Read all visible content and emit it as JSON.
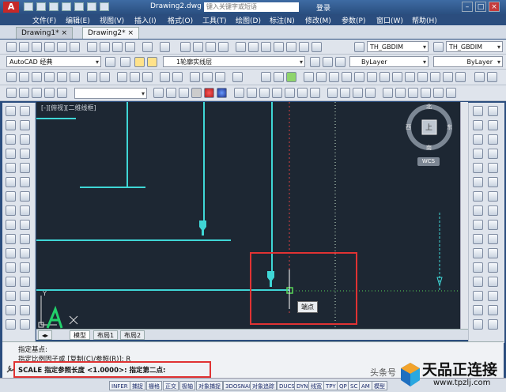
{
  "title": {
    "doc_title": "Drawing2.dwg",
    "search_placeholder": "键入关键字或短语",
    "login": "登录"
  },
  "menu": [
    "文件(F)",
    "编辑(E)",
    "视图(V)",
    "插入(I)",
    "格式(O)",
    "工具(T)",
    "绘图(D)",
    "标注(N)",
    "修改(M)",
    "参数(P)",
    "窗口(W)",
    "帮助(H)"
  ],
  "doc_tabs": [
    "Drawing1*",
    "Drawing2*"
  ],
  "toolbars": {
    "text_style": "TH_GBDIM",
    "dim_style": "TH_GBDIM",
    "workspace": "AutoCAD 经典",
    "layer": "1轮廓实线层",
    "color": "ByLayer",
    "linetype": "ByLayer"
  },
  "viewport": {
    "label": "[-][俯视][二维线框]",
    "viewcube_top": "上",
    "compass_n": "北",
    "compass_s": "南",
    "compass_e": "东",
    "compass_w": "西",
    "wcs": "WCS",
    "ucs_y": "Y",
    "snap_tooltip": "端点"
  },
  "layout_tabs": [
    "模型",
    "布局1",
    "布局2"
  ],
  "command": {
    "line1": "指定基点:",
    "line2": "指定比例因子或 [复制(C)/参照(R)]: R",
    "prompt": "SCALE 指定参照长度 <1.0000>:  指定第二点:"
  },
  "status_buttons": [
    "INFER",
    "捕捉",
    "栅格",
    "正交",
    "极轴",
    "对象捕捉",
    "3DOSNAP",
    "对象追踪",
    "DUCS",
    "DYN",
    "线宽",
    "TPY",
    "QP",
    "SC",
    "AM",
    "模型"
  ],
  "watermark": {
    "name": "天品正连接",
    "url": "www.tpzlj.com",
    "source": "头条号"
  }
}
